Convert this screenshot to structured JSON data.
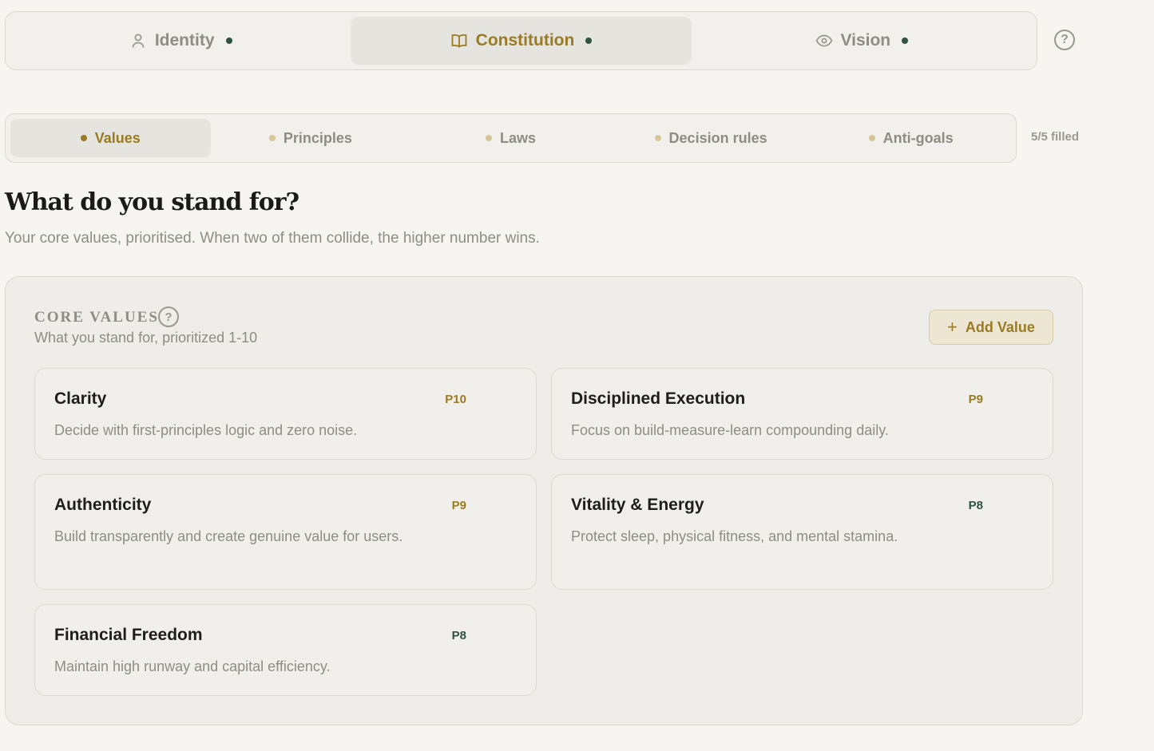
{
  "top_tabs": [
    {
      "label": "Identity",
      "icon": "person-icon",
      "active": false
    },
    {
      "label": "Constitution",
      "icon": "book-icon",
      "active": true
    },
    {
      "label": "Vision",
      "icon": "eye-icon",
      "active": false
    }
  ],
  "sub_tabs": [
    {
      "label": "Values",
      "active": true
    },
    {
      "label": "Principles",
      "active": false
    },
    {
      "label": "Laws",
      "active": false
    },
    {
      "label": "Decision rules",
      "active": false
    },
    {
      "label": "Anti-goals",
      "active": false
    }
  ],
  "filled_status": "5/5 filled",
  "heading": {
    "title": "What do you stand for?",
    "subtitle": "Your core values, prioritised. When two of them collide, the higher number wins."
  },
  "panel": {
    "title": "CORE VALUES",
    "subtitle": "What you stand for, prioritized 1-10",
    "add_button": "Add Value"
  },
  "values": [
    {
      "name": "Clarity",
      "priority": "P10",
      "description": "Decide with first-principles logic and zero noise."
    },
    {
      "name": "Disciplined Execution",
      "priority": "P9",
      "description": "Focus on build-measure-learn compounding daily."
    },
    {
      "name": "Authenticity",
      "priority": "P9",
      "description": "Build transparently and create genuine value for users."
    },
    {
      "name": "Vitality & Energy",
      "priority": "P8",
      "description": "Protect sleep, physical fitness, and mental stamina."
    },
    {
      "name": "Financial Freedom",
      "priority": "P8",
      "description": "Maintain high runway and capital efficiency."
    }
  ],
  "colors": {
    "accent": "#9a7b22",
    "priority_high": "#9a7b22",
    "priority_mid": "#2f5141",
    "status_dot": "#2f5141"
  }
}
